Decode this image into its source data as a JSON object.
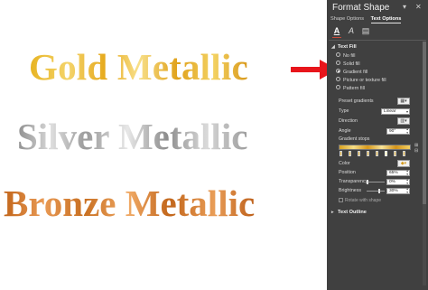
{
  "canvas": {
    "gold_text": "Gold Metallic",
    "silver_text": "Silver Metallic",
    "bronze_text": "Bronze Metallic"
  },
  "pane": {
    "title": "Format Shape",
    "tabs": [
      {
        "label": "Shape Options",
        "active": false
      },
      {
        "label": "Text Options",
        "active": true
      }
    ],
    "icons": [
      {
        "name": "text-fill-outline-icon",
        "glyph": "A",
        "selected": true
      },
      {
        "name": "text-effects-icon",
        "glyph": "A",
        "selected": false
      },
      {
        "name": "textbox-icon",
        "glyph": "▤",
        "selected": false
      }
    ],
    "text_fill": {
      "header": "Text Fill",
      "options": [
        {
          "label": "No fill",
          "selected": false
        },
        {
          "label": "Solid fill",
          "selected": false
        },
        {
          "label": "Gradient fill",
          "selected": true
        },
        {
          "label": "Picture or texture fill",
          "selected": false
        },
        {
          "label": "Pattern fill",
          "selected": false
        }
      ],
      "preset_label": "Preset gradients",
      "type_label": "Type",
      "type_value": "Linear",
      "direction_label": "Direction",
      "angle_label": "Angle",
      "angle_value": "90°",
      "stops_label": "Gradient stops",
      "color_label": "Color",
      "position_label": "Position",
      "position_value": "65%",
      "transparency_label": "Transparency",
      "transparency_value": "0%",
      "brightness_label": "Brightness",
      "brightness_value": "30%",
      "rotate_label": "Rotate with shape"
    },
    "text_outline_header": "Text Outline"
  },
  "colors": {
    "pane_bg": "#404040",
    "arrow": "#e8151b",
    "gold": "#e7b321",
    "silver": "#9a9a9a",
    "bronze": "#c86f21"
  }
}
